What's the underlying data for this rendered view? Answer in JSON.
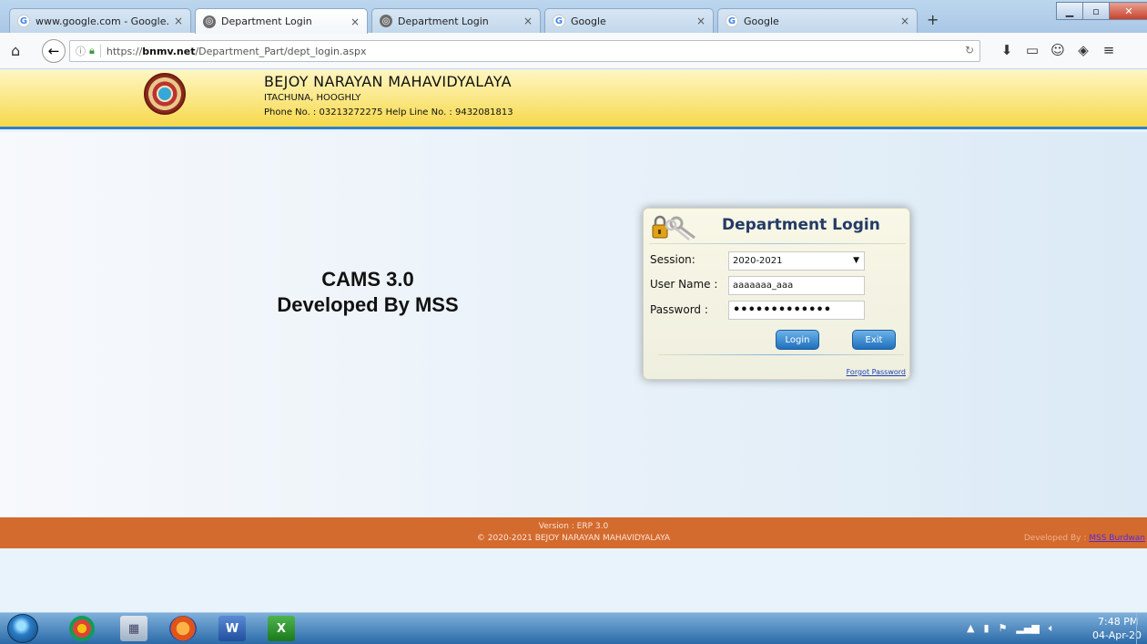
{
  "browser": {
    "tabs": [
      {
        "title": "www.google.com - Google...",
        "favicon": "google-icon",
        "active": false
      },
      {
        "title": "Department Login",
        "favicon": "cams-icon",
        "active": true
      },
      {
        "title": "Department Login",
        "favicon": "cams-icon",
        "active": false
      },
      {
        "title": "Google",
        "favicon": "google-icon",
        "active": false
      },
      {
        "title": "Google",
        "favicon": "google-icon",
        "active": false
      }
    ],
    "url_prefix": "https://",
    "url_host": "bnmv.net",
    "url_path": "/Department_Part/dept_login.aspx",
    "new_tab": "+"
  },
  "header": {
    "college_name": "BEJOY NARAYAN MAHAVIDYALAYA",
    "address": "ITACHUNA, HOOGHLY",
    "phone": "Phone No. : 03213272275  Help Line No. : 9432081813"
  },
  "main": {
    "cams_line1": "CAMS 3.0",
    "cams_line2": "Developed By MSS"
  },
  "login": {
    "title": "Department Login",
    "session_label": "Session:",
    "session_value": "2020-2021",
    "username_label": "User Name :",
    "username_value": "aaaaaaa_aaa",
    "password_label": "Password :",
    "password_value": "•••••••••••••",
    "login_button": "Login",
    "exit_button": "Exit",
    "forgot_link": "Forgot Password"
  },
  "footer": {
    "version": "Version : ERP 3.0",
    "copyright": "© 2020-2021  BEJOY NARAYAN MAHAVIDYALAYA",
    "developed_by_label": "Developed By : ",
    "developed_by_link": "MSS Burdwan",
    "bg_color": "#d36a2e"
  },
  "taskbar": {
    "time": "7:48 PM",
    "date": "04-Apr-20"
  },
  "colors": {
    "header_yellow": "#f6d94b",
    "header_border": "#2f7fcd",
    "button_blue": "#1f6fbc",
    "login_title": "#233b66"
  }
}
